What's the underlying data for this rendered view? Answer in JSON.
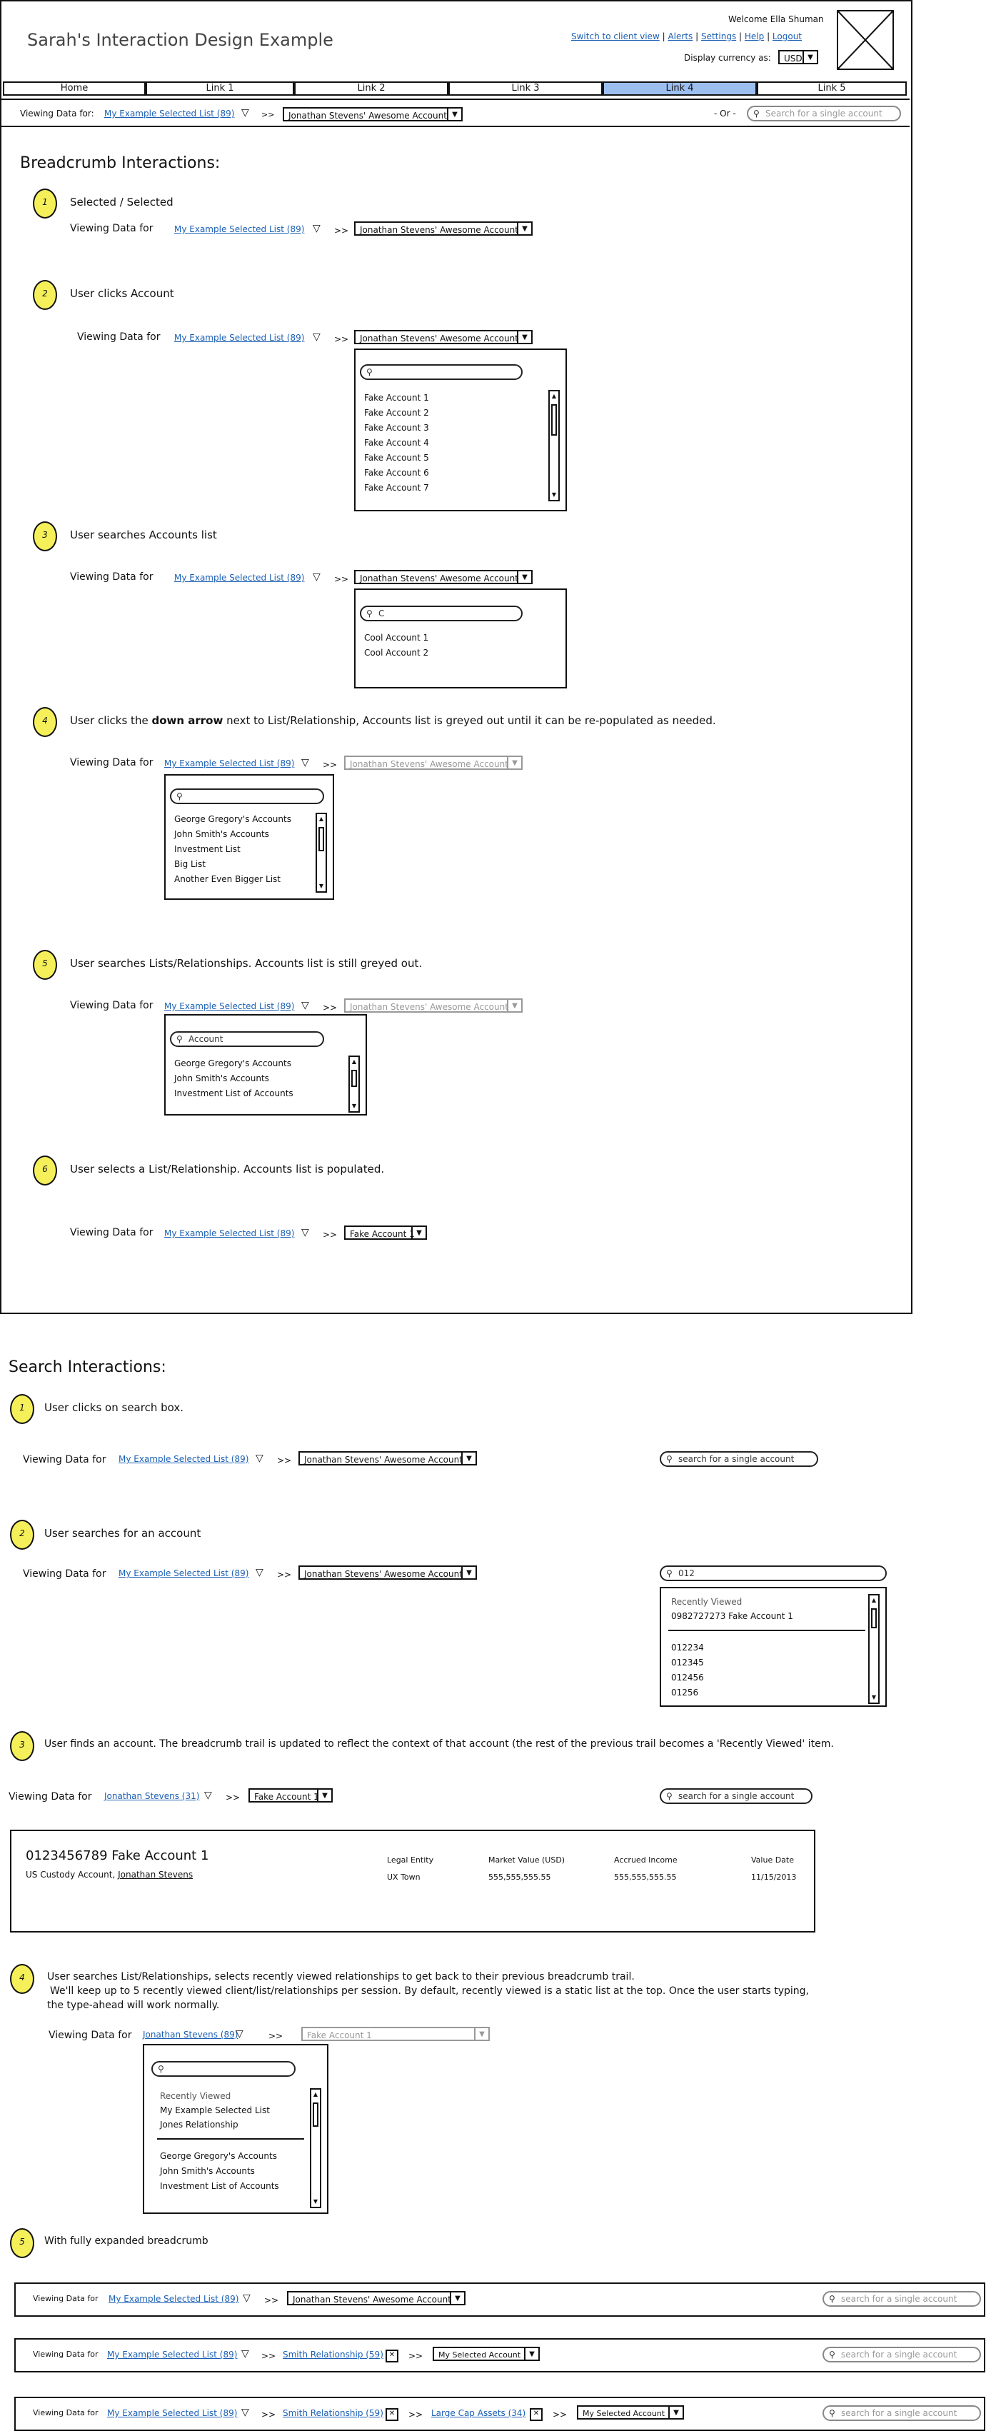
{
  "app": {
    "title": "Sarah's Interaction Design Example",
    "welcome": "Welcome Ella Shuman",
    "top_links": [
      "Switch to client view",
      "Alerts",
      "Settings",
      "Help",
      "Logout"
    ],
    "currency_label": "Display currency as:",
    "currency_value": "USD"
  },
  "nav": [
    "Home",
    "Link 1",
    "Link 2",
    "Link 3",
    "Link 4",
    "Link 5"
  ],
  "bar": {
    "viewing_label": "Viewing Data for:",
    "list": "My Example Selected List (89)",
    "sep": ">>",
    "account": "Jonathan Stevens' Awesome Account",
    "or": "- Or -",
    "search_placeholder": "Search for a single account"
  },
  "breadcrumb": {
    "title": "Breadcrumb Interactions:",
    "viewing_label": "Viewing Data for",
    "list": "My Example Selected List (89)",
    "account": "Jonathan Stevens' Awesome Account",
    "steps": [
      {
        "num": "1",
        "text": "Selected / Selected"
      },
      {
        "num": "2",
        "text": "User clicks Account"
      },
      {
        "num": "3",
        "text": "User searches Accounts list"
      },
      {
        "num": "4",
        "text_a": "User clicks the ",
        "text_b": "down arrow",
        "text_c": " next to List/Relationship, Accounts list is greyed out until it can be re-populated as needed."
      },
      {
        "num": "5",
        "text": "User searches Lists/Relationships. Accounts list is still greyed out."
      },
      {
        "num": "6",
        "text": "User selects a List/Relationship. Accounts list is populated."
      }
    ],
    "fake_accounts": [
      "Fake Account 1",
      "Fake Account 2",
      "Fake Account 3",
      "Fake Account 4",
      "Fake Account 5",
      "Fake Account 6",
      "Fake Account 7"
    ],
    "search_c": "C",
    "cool_accounts": [
      "Cool Account 1",
      "Cool Account 2"
    ],
    "lists": [
      "George Gregory's Accounts",
      "John Smith's Accounts",
      "Investment List",
      "Big List",
      "Another Even Bigger List"
    ],
    "search_account": "Account",
    "lists_filtered": [
      "George Gregory's Accounts",
      "John Smith's Accounts",
      "Investment List of Accounts"
    ],
    "selected_account": "Fake Account 1"
  },
  "search": {
    "title": "Search Interactions:",
    "steps": [
      {
        "num": "1",
        "text": "User clicks on search box."
      },
      {
        "num": "2",
        "text": "User searches for an account"
      },
      {
        "num": "3",
        "text": "User finds an account. The breadcrumb trail is updated to reflect the context of that account (the rest of the previous trail becomes a 'Recently Viewed' item."
      },
      {
        "num": "4",
        "text_1": "User searches List/Relationships, selects recently viewed relationships to get back to their previous breadcrumb trail.",
        "text_2": "We'll keep up to 5 recently viewed client/list/relationships per session. By default, recently viewed is a static list at the top. Once the user starts typing,",
        "text_3": "the type-ahead will work normally."
      },
      {
        "num": "5",
        "text": "With fully expanded breadcrumb"
      }
    ],
    "search_placeholder": "search for a single account",
    "search_query": "012",
    "recently_viewed_label": "Recently Viewed",
    "recent_account": "0982727273 Fake Account 1",
    "results": [
      "012234",
      "012345",
      "012456",
      "01256"
    ],
    "client": "Jonathan Stevens (31)",
    "client_89": "Jonathan Stevens (89)",
    "account_card": {
      "title": "0123456789 Fake Account 1",
      "subtitle": "US Custody Account,",
      "owner": "Jonathan Stevens",
      "headers": [
        "Legal Entity",
        "Market Value (USD)",
        "Accrued Income",
        "Value Date"
      ],
      "values": [
        "UX Town",
        "555,555,555.55",
        "555,555,555.55",
        "11/15/2013"
      ]
    },
    "recent_lists": [
      "My Example Selected List",
      "Jones Relationship"
    ],
    "smith": "Smith Relationship (59)",
    "largecap": "Large Cap Assets (34)",
    "my_selected_account": "My Selected Account"
  }
}
